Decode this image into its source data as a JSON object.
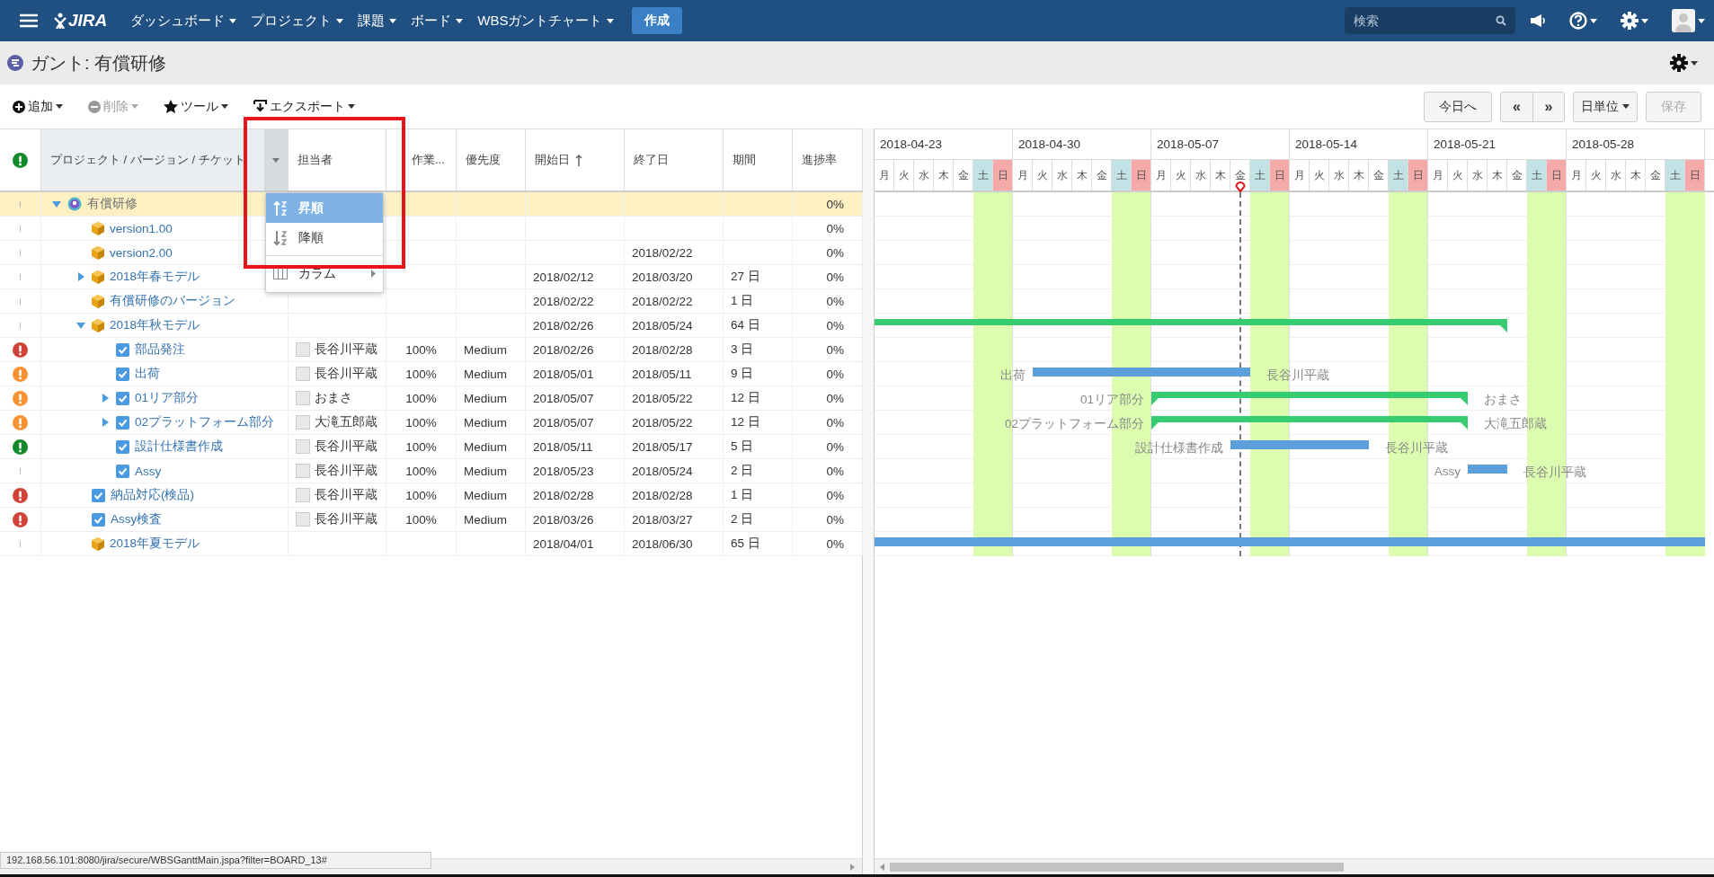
{
  "nav": {
    "menus": [
      {
        "label": "ダッシュボード"
      },
      {
        "label": "プロジェクト"
      },
      {
        "label": "課題"
      },
      {
        "label": "ボード"
      },
      {
        "label": "WBSガントチャート"
      }
    ],
    "logo": "JIRA",
    "create": "作成",
    "search": {
      "placeholder": "検索"
    }
  },
  "page": {
    "title": "ガント: 有償研修"
  },
  "toolbar": {
    "left": [
      {
        "label": "追加",
        "kind": "add",
        "disabled": false
      },
      {
        "label": "削除",
        "kind": "remove",
        "disabled": true
      },
      {
        "label": "ツール",
        "kind": "tools",
        "disabled": false
      },
      {
        "label": "エクスポート",
        "kind": "export",
        "disabled": false
      }
    ],
    "today": "今日へ",
    "prev": "«",
    "next": "»",
    "scale": "日単位",
    "save": {
      "label": "保存",
      "disabled": true
    }
  },
  "table": {
    "columns": [
      {
        "label": "プロジェクト / バージョン / チケット",
        "sorted": false
      },
      {
        "label": "担当者",
        "sorted": false
      },
      {
        "label": "作業...",
        "sorted": false
      },
      {
        "label": "優先度",
        "sorted": false
      },
      {
        "label": "開始日",
        "sorted": true
      },
      {
        "label": "終了日",
        "sorted": false
      },
      {
        "label": "期間",
        "sorted": false
      },
      {
        "label": "進捗率",
        "sorted": false
      }
    ],
    "rows": [
      {
        "name": "有償研修",
        "kind": "project",
        "selected": true,
        "expanded": true,
        "progress": "0%",
        "children": [
          {
            "name": "version1.00",
            "kind": "version",
            "selected": false,
            "progress": "0%"
          },
          {
            "name": "version2.00",
            "kind": "version",
            "selected": false,
            "end": "2018/02/22",
            "progress": "0%"
          },
          {
            "name": "2018年春モデル",
            "kind": "version",
            "selected": false,
            "expanded": false,
            "start": "2018/02/12",
            "end": "2018/03/20",
            "duration": "27 日",
            "progress": "0%"
          },
          {
            "name": "有償研修のバージョン",
            "kind": "version",
            "selected": false,
            "start": "2018/02/22",
            "end": "2018/02/22",
            "duration": "1 日",
            "progress": "0%"
          },
          {
            "name": "2018年秋モデル",
            "kind": "version",
            "selected": false,
            "expanded": true,
            "start": "2018/02/26",
            "end": "2018/05/24",
            "duration": "64 日",
            "progress": "0%",
            "bar": {
              "kind": "summary"
            },
            "children": [
              {
                "name": "部品発注",
                "kind": "task",
                "selected": false,
                "color": "#d04437",
                "assignee": "長谷川平蔵",
                "work": "100%",
                "priority": "Medium",
                "start": "2018/02/26",
                "end": "2018/02/28",
                "duration": "3 日",
                "progress": "0%"
              },
              {
                "name": "出荷",
                "kind": "task",
                "selected": false,
                "color": "#f79232",
                "assignee": "長谷川平蔵",
                "work": "100%",
                "priority": "Medium",
                "start": "2018/05/01",
                "end": "2018/05/11",
                "duration": "9 日",
                "progress": "0%",
                "bar": {
                  "kind": "task",
                  "left_label": "出荷",
                  "right_label": "長谷川平蔵"
                }
              },
              {
                "name": "01リア部分",
                "kind": "task",
                "selected": false,
                "expanded": false,
                "color": "#f79232",
                "assignee": "おまさ",
                "work": "100%",
                "priority": "Medium",
                "start": "2018/05/07",
                "end": "2018/05/22",
                "duration": "12 日",
                "progress": "0%",
                "bar": {
                  "kind": "summary",
                  "left_label": "01リア部分",
                  "right_label": "おまさ"
                }
              },
              {
                "name": "02プラットフォーム部分",
                "kind": "task",
                "selected": false,
                "expanded": false,
                "color": "#f79232",
                "assignee": "大滝五郎蔵",
                "work": "100%",
                "priority": "Medium",
                "start": "2018/05/07",
                "end": "2018/05/22",
                "duration": "12 日",
                "progress": "0%",
                "bar": {
                  "kind": "summary",
                  "left_label": "02プラットフォーム部分",
                  "right_label": "大滝五郎蔵"
                }
              },
              {
                "name": "設計仕様書作成",
                "kind": "task",
                "selected": false,
                "color": "#14892c",
                "assignee": "長谷川平蔵",
                "work": "100%",
                "priority": "Medium",
                "start": "2018/05/11",
                "end": "2018/05/17",
                "duration": "5 日",
                "progress": "0%",
                "bar": {
                  "kind": "task",
                  "left_label": "設計仕様書作成",
                  "right_label": "長谷川平蔵"
                }
              },
              {
                "name": "Assy",
                "kind": "task",
                "selected": false,
                "assignee": "長谷川平蔵",
                "work": "100%",
                "priority": "Medium",
                "start": "2018/05/23",
                "end": "2018/05/24",
                "duration": "2 日",
                "progress": "0%",
                "bar": {
                  "kind": "task",
                  "left_label": "Assy",
                  "right_label": "長谷川平蔵"
                }
              }
            ]
          },
          {
            "name": "納品対応(検品)",
            "kind": "task",
            "selected": false,
            "color": "#d04437",
            "assignee": "長谷川平蔵",
            "work": "100%",
            "priority": "Medium",
            "start": "2018/02/28",
            "end": "2018/02/28",
            "duration": "1 日",
            "progress": "0%"
          },
          {
            "name": "Assy検査",
            "kind": "task",
            "selected": false,
            "color": "#d04437",
            "assignee": "長谷川平蔵",
            "work": "100%",
            "priority": "Medium",
            "start": "2018/03/26",
            "end": "2018/03/27",
            "duration": "2 日",
            "progress": "0%"
          },
          {
            "name": "2018年夏モデル",
            "kind": "version",
            "selected": false,
            "start": "2018/04/01",
            "end": "2018/06/30",
            "duration": "65 日",
            "progress": "0%",
            "bar": {
              "kind": "task"
            }
          }
        ]
      }
    ]
  },
  "menu": {
    "items": [
      {
        "label": "昇順",
        "kind": "asc",
        "selected": true
      },
      {
        "label": "降順",
        "kind": "desc",
        "selected": false
      },
      {
        "label": "カラム",
        "kind": "submenu",
        "selected": false
      }
    ]
  },
  "gantt": {
    "weeks": [
      "2018-04-23",
      "2018-04-30",
      "2018-05-07",
      "2018-05-14",
      "2018-05-21",
      "2018-05-28"
    ],
    "days": [
      {
        "label": "月",
        "kind": "weekday",
        "today": false
      },
      {
        "label": "火",
        "kind": "weekday",
        "today": false
      },
      {
        "label": "水",
        "kind": "weekday",
        "today": false
      },
      {
        "label": "木",
        "kind": "weekday",
        "today": false
      },
      {
        "label": "金",
        "kind": "weekday",
        "today": false
      },
      {
        "label": "土",
        "kind": "saturday",
        "today": false
      },
      {
        "label": "日",
        "kind": "sunday",
        "today": false
      },
      {
        "label": "月",
        "kind": "weekday",
        "today": false
      },
      {
        "label": "火",
        "kind": "weekday",
        "today": false
      },
      {
        "label": "水",
        "kind": "weekday",
        "today": false
      },
      {
        "label": "木",
        "kind": "weekday",
        "today": false
      },
      {
        "label": "金",
        "kind": "weekday",
        "today": false
      },
      {
        "label": "土",
        "kind": "saturday",
        "today": false
      },
      {
        "label": "日",
        "kind": "sunday",
        "today": false
      },
      {
        "label": "月",
        "kind": "weekday",
        "today": false
      },
      {
        "label": "火",
        "kind": "weekday",
        "today": false
      },
      {
        "label": "水",
        "kind": "weekday",
        "today": false
      },
      {
        "label": "木",
        "kind": "weekday",
        "today": false
      },
      {
        "label": "金",
        "kind": "weekday",
        "today": true
      },
      {
        "label": "土",
        "kind": "saturday",
        "today": false
      },
      {
        "label": "日",
        "kind": "sunday",
        "today": false
      },
      {
        "label": "月",
        "kind": "weekday",
        "today": false
      },
      {
        "label": "火",
        "kind": "weekday",
        "today": false
      },
      {
        "label": "水",
        "kind": "weekday",
        "today": false
      },
      {
        "label": "木",
        "kind": "weekday",
        "today": false
      },
      {
        "label": "金",
        "kind": "weekday",
        "today": false
      },
      {
        "label": "土",
        "kind": "saturday",
        "today": false
      },
      {
        "label": "日",
        "kind": "sunday",
        "today": false
      },
      {
        "label": "月",
        "kind": "weekday",
        "today": false
      },
      {
        "label": "火",
        "kind": "weekday",
        "today": false
      },
      {
        "label": "水",
        "kind": "weekday",
        "today": false
      },
      {
        "label": "木",
        "kind": "weekday",
        "today": false
      },
      {
        "label": "金",
        "kind": "weekday",
        "today": false
      },
      {
        "label": "土",
        "kind": "saturday",
        "today": false
      },
      {
        "label": "日",
        "kind": "sunday",
        "today": false
      },
      {
        "label": "月",
        "kind": "weekday",
        "today": false
      },
      {
        "label": "火",
        "kind": "weekday",
        "today": false
      },
      {
        "label": "水",
        "kind": "weekday",
        "today": false
      },
      {
        "label": "木",
        "kind": "weekday",
        "today": false
      },
      {
        "label": "金",
        "kind": "weekday",
        "today": false
      },
      {
        "label": "土",
        "kind": "saturday",
        "today": false
      },
      {
        "label": "日",
        "kind": "sunday",
        "today": false
      }
    ]
  },
  "status_url": "192.168.56.101:8080/jira/secure/WBSGanttMain.jspa?filter=BOARD_13#"
}
